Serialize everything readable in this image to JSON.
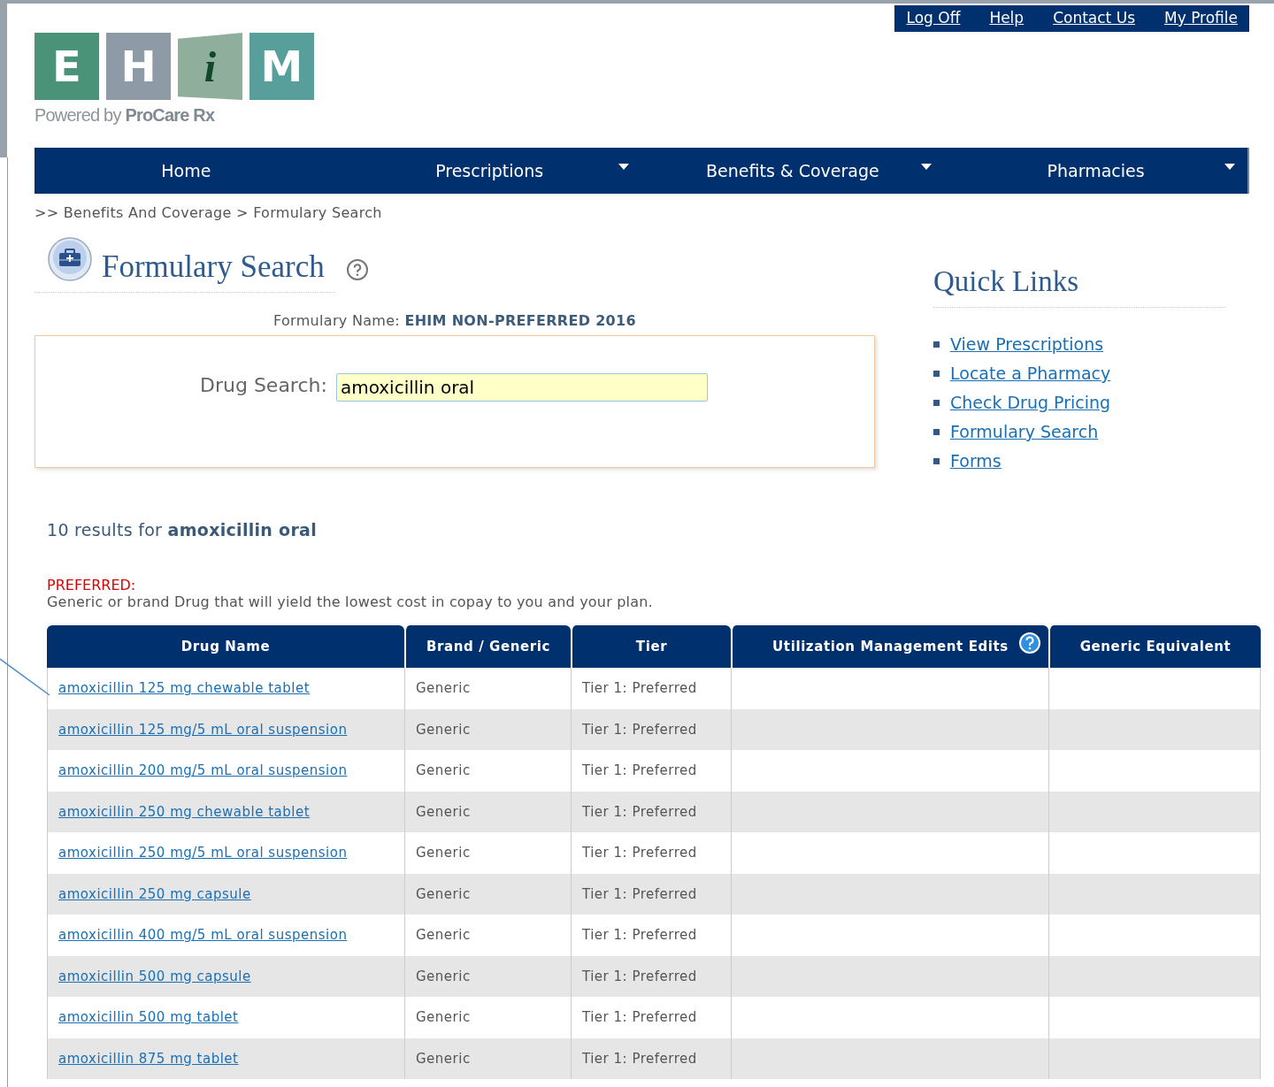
{
  "top_links": [
    "Log Off",
    "Help",
    "Contact Us",
    "My Profile"
  ],
  "logo": {
    "letters": [
      "E",
      "H",
      "i",
      "M"
    ],
    "tagline": "Powered by **ProCare Rx**"
  },
  "nav": [
    {
      "label": "Home",
      "has_menu": false
    },
    {
      "label": "Prescriptions",
      "has_menu": true
    },
    {
      "label": "Benefits & Coverage",
      "has_menu": true
    },
    {
      "label": "Pharmacies",
      "has_menu": true
    }
  ],
  "breadcrumb": ">> Benefits And Coverage > Formulary Search",
  "page_title": "Formulary Search",
  "formulary": {
    "label": "Formulary Name:",
    "value": "EHIM NON-PREFERRED 2016"
  },
  "search": {
    "label": "Drug Search:",
    "value": "amoxicillin oral"
  },
  "quick_links": {
    "title": "Quick Links",
    "items": [
      "View Prescriptions",
      "Locate a Pharmacy",
      "Check Drug Pricing",
      "Formulary Search",
      "Forms"
    ]
  },
  "results_summary": "10 results for **amoxicillin oral**",
  "legend": {
    "title": "PREFERRED:",
    "text": "Generic or brand Drug that will yield the lowest cost in copay to you and your plan."
  },
  "table": {
    "columns": [
      {
        "label": "Drug Name",
        "help": false
      },
      {
        "label": "Brand / Generic",
        "help": false
      },
      {
        "label": "Tier",
        "help": false
      },
      {
        "label": "Utilization Management Edits",
        "help": true
      },
      {
        "label": "Generic Equivalent",
        "help": false
      }
    ],
    "rows": [
      {
        "drug": "amoxicillin 125 mg chewable tablet",
        "type": "Generic",
        "tier": "Tier 1: Preferred"
      },
      {
        "drug": "amoxicillin 125 mg/5 mL oral suspension",
        "type": "Generic",
        "tier": "Tier 1: Preferred"
      },
      {
        "drug": "amoxicillin 200 mg/5 mL oral suspension",
        "type": "Generic",
        "tier": "Tier 1: Preferred"
      },
      {
        "drug": "amoxicillin 250 mg chewable tablet",
        "type": "Generic",
        "tier": "Tier 1: Preferred"
      },
      {
        "drug": "amoxicillin 250 mg/5 mL oral suspension",
        "type": "Generic",
        "tier": "Tier 1: Preferred"
      },
      {
        "drug": "amoxicillin 250 mg capsule",
        "type": "Generic",
        "tier": "Tier 1: Preferred"
      },
      {
        "drug": "amoxicillin 400 mg/5 mL oral suspension",
        "type": "Generic",
        "tier": "Tier 1: Preferred"
      },
      {
        "drug": "amoxicillin 500 mg capsule",
        "type": "Generic",
        "tier": "Tier 1: Preferred"
      },
      {
        "drug": "amoxicillin 500 mg tablet",
        "type": "Generic",
        "tier": "Tier 1: Preferred"
      },
      {
        "drug": "amoxicillin 875 mg tablet",
        "type": "Generic",
        "tier": "Tier 1: Preferred"
      }
    ]
  }
}
